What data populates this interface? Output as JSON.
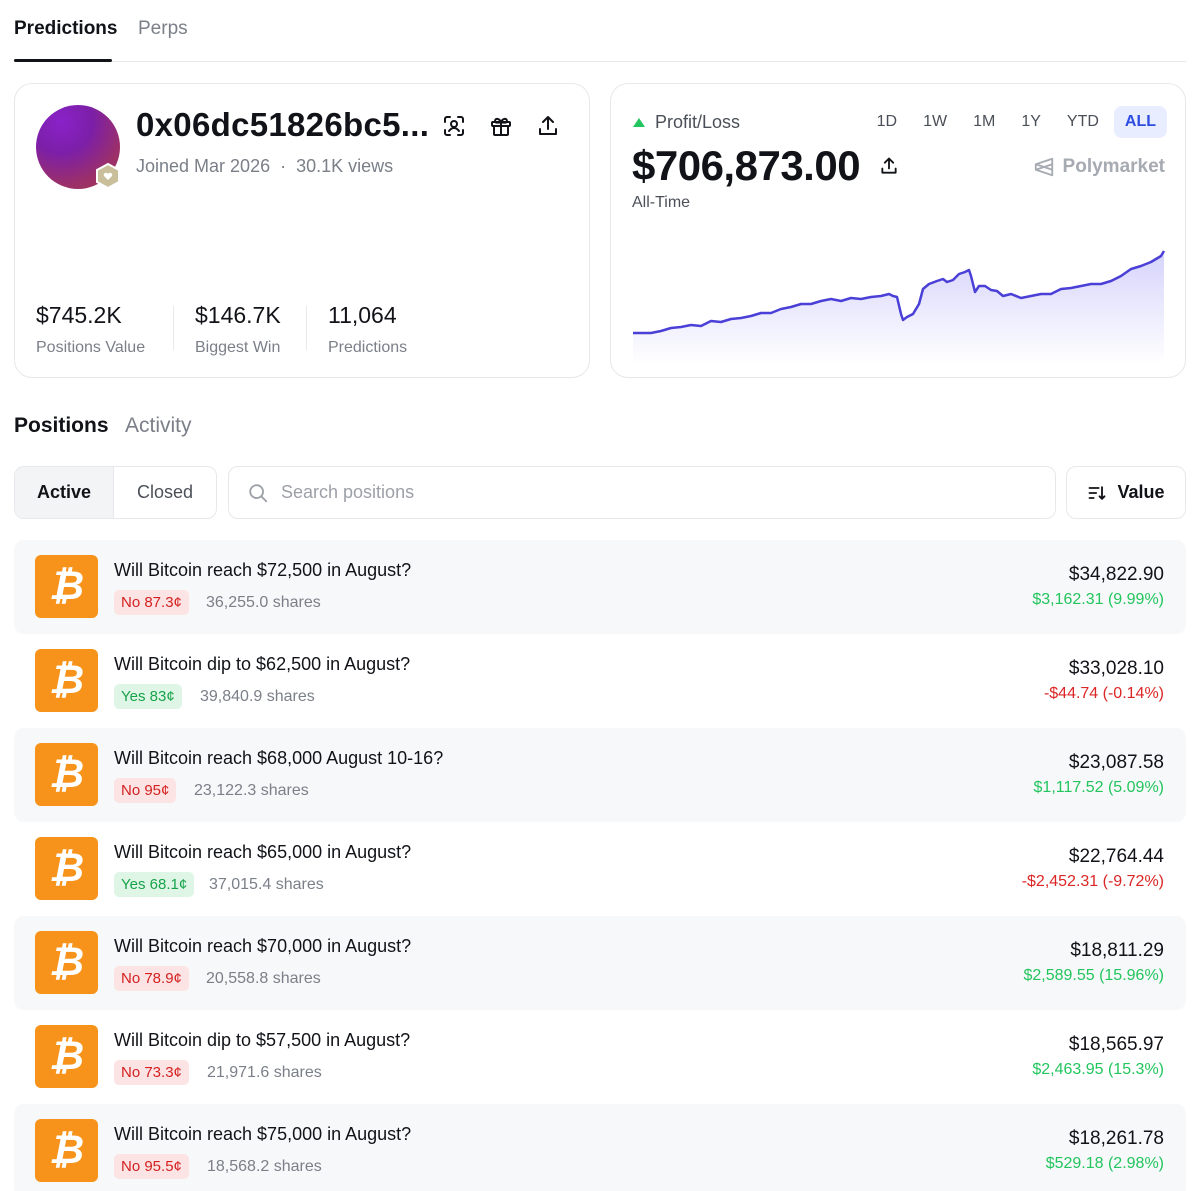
{
  "top_tabs": [
    "Predictions",
    "Perps"
  ],
  "profile": {
    "name": "0x06dc51826bc5...",
    "joined": "Joined Mar 2026",
    "separator": "·",
    "views": "30.1K views",
    "stats": [
      {
        "value": "$745.2K",
        "label": "Positions Value"
      },
      {
        "value": "$146.7K",
        "label": "Biggest Win"
      },
      {
        "value": "11,064",
        "label": "Predictions"
      }
    ]
  },
  "pnl": {
    "title": "Profit/Loss",
    "value": "$706,873.00",
    "period": "All-Time",
    "brand": "Polymarket",
    "ranges": [
      "1D",
      "1W",
      "1M",
      "1Y",
      "YTD",
      "ALL"
    ],
    "active_range": "ALL",
    "colors": {
      "line": "#4a3fd6",
      "up": "#22c55e"
    }
  },
  "section_tabs": [
    "Positions",
    "Activity"
  ],
  "filter": {
    "active": "Active",
    "closed": "Closed"
  },
  "search": {
    "placeholder": "Search positions"
  },
  "sort": {
    "label": "Value"
  },
  "positions": [
    {
      "title": "Will Bitcoin reach $72,500 in August?",
      "pill": "No 87.3¢",
      "side": "no",
      "shares": "36,255.0 shares",
      "value": "$34,822.90",
      "change": "$3,162.31 (9.99%)",
      "dir": "pos"
    },
    {
      "title": "Will Bitcoin dip to $62,500 in August?",
      "pill": "Yes 83¢",
      "side": "yes",
      "shares": "39,840.9 shares",
      "value": "$33,028.10",
      "change": "-$44.74 (-0.14%)",
      "dir": "neg"
    },
    {
      "title": "Will Bitcoin reach $68,000 August 10-16?",
      "pill": "No 95¢",
      "side": "no",
      "shares": "23,122.3 shares",
      "value": "$23,087.58",
      "change": "$1,117.52 (5.09%)",
      "dir": "pos"
    },
    {
      "title": "Will Bitcoin reach $65,000 in August?",
      "pill": "Yes 68.1¢",
      "side": "yes",
      "shares": "37,015.4 shares",
      "value": "$22,764.44",
      "change": "-$2,452.31 (-9.72%)",
      "dir": "neg"
    },
    {
      "title": "Will Bitcoin reach $70,000 in August?",
      "pill": "No 78.9¢",
      "side": "no",
      "shares": "20,558.8 shares",
      "value": "$18,811.29",
      "change": "$2,589.55 (15.96%)",
      "dir": "pos"
    },
    {
      "title": "Will Bitcoin dip to $57,500 in August?",
      "pill": "No 73.3¢",
      "side": "no",
      "shares": "21,971.6 shares",
      "value": "$18,565.97",
      "change": "$2,463.95 (15.3%)",
      "dir": "pos"
    },
    {
      "title": "Will Bitcoin reach $75,000 in August?",
      "pill": "No 95.5¢",
      "side": "no",
      "shares": "18,568.2 shares",
      "value": "$18,261.78",
      "change": "$529.18 (2.98%)",
      "dir": "pos"
    }
  ],
  "position_icon": "bitcoin-icon",
  "position_icon_glyph": "₿"
}
